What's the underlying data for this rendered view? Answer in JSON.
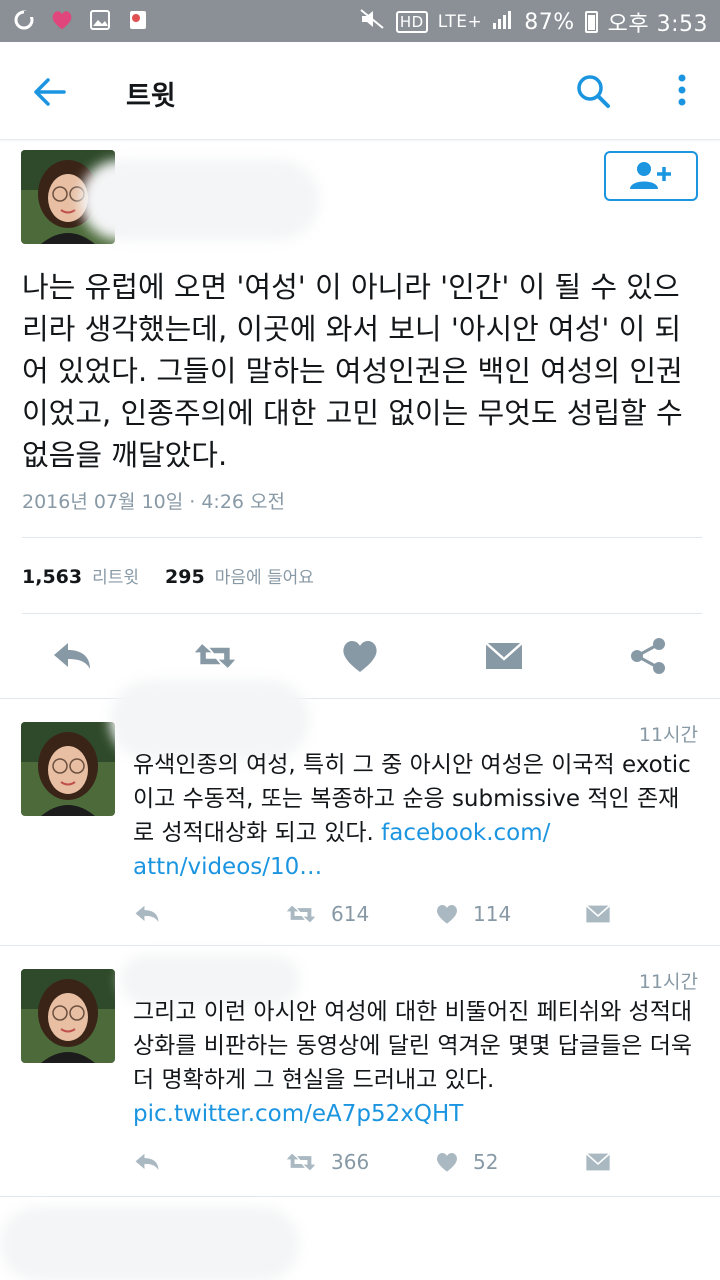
{
  "status_bar": {
    "battery": "87%",
    "time": "오후 3:53",
    "network": "LTE+",
    "hd": "HD"
  },
  "header": {
    "title": "트윗"
  },
  "tweet": {
    "text": "나는 유럽에 오면 '여성' 이 아니라 '인간' 이 될 수 있으리라 생각했는데, 이곳에 와서 보니 '아시안 여성' 이 되어 있었다. 그들이 말하는 여성인권은 백인 여성의 인권이었고, 인종주의에 대한 고민 없이는 무엇도 성립할 수 없음을 깨달았다.",
    "timestamp": "2016년 07월 10일 · 4:26 오전",
    "retweets": "1,563",
    "retweets_label": "리트윗",
    "likes": "295",
    "likes_label": "마음에 들어요"
  },
  "replies": [
    {
      "time": "11시간",
      "text": "유색인종의 여성, 특히 그 중 아시안 여성은 이국적 exotic이고 수동적, 또는 복종하고 순응 submissive 적인 존재로 성적대상화 되고 있다. ",
      "link": "facebook.com/ attn/videos/10…",
      "retweets": "614",
      "likes": "114"
    },
    {
      "time": "11시간",
      "text": "그리고 이런 아시안 여성에 대한 비뚤어진 페티쉬와 성적대상화를 비판하는 동영상에 달린 역겨운 몇몇 답글들은 더욱 더 명확하게 그 현실을 드러내고 있다. ",
      "link": "pic.twitter.com/eA7p52xQHT",
      "retweets": "366",
      "likes": "52"
    }
  ],
  "colors": {
    "accent": "#1b95e0",
    "muted": "#8899a6",
    "icon": "#aab8c2"
  }
}
